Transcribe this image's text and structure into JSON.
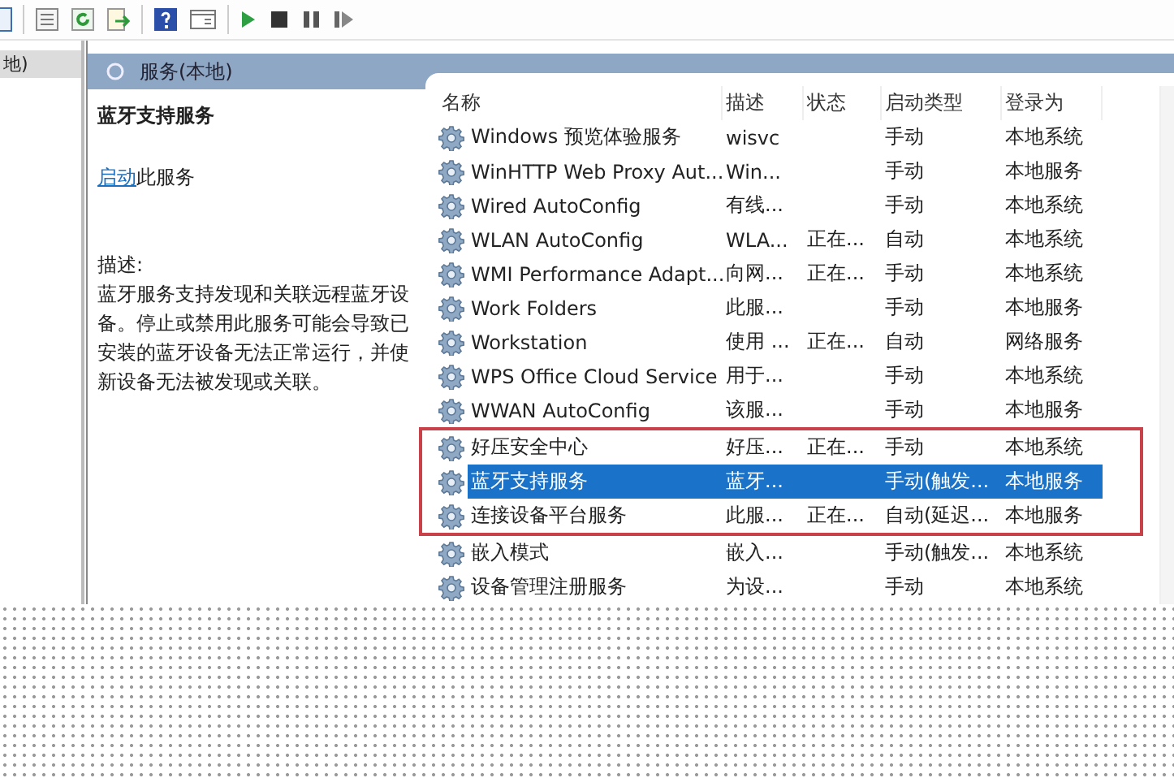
{
  "tree": {
    "items": [
      {
        "label": "地)",
        "selected": true
      }
    ]
  },
  "header": {
    "title": "服务(本地)"
  },
  "detail": {
    "title": "蓝牙支持服务",
    "action_link": "启动",
    "action_text": "此服务",
    "description_label": "描述:",
    "description": "蓝牙服务支持发现和关联远程蓝牙设备。停止或禁用此服务可能会导致已安装的蓝牙设备无法正常运行，并使新设备无法被发现或关联。"
  },
  "table": {
    "columns": [
      "名称",
      "描述",
      "状态",
      "启动类型",
      "登录为"
    ],
    "rows": [
      {
        "name": "Windows 预览体验服务",
        "description": "wisvc",
        "status": "",
        "startup": "手动",
        "logon": "本地系统",
        "selected": false,
        "marked": false
      },
      {
        "name": "WinHTTP Web Proxy Aut...",
        "description": "Win...",
        "status": "",
        "startup": "手动",
        "logon": "本地服务",
        "selected": false,
        "marked": false
      },
      {
        "name": "Wired AutoConfig",
        "description": "有线...",
        "status": "",
        "startup": "手动",
        "logon": "本地系统",
        "selected": false,
        "marked": false
      },
      {
        "name": "WLAN AutoConfig",
        "description": "WLA...",
        "status": "正在...",
        "startup": "自动",
        "logon": "本地系统",
        "selected": false,
        "marked": false
      },
      {
        "name": "WMI Performance Adapt...",
        "description": "向网...",
        "status": "正在...",
        "startup": "手动",
        "logon": "本地系统",
        "selected": false,
        "marked": false
      },
      {
        "name": "Work Folders",
        "description": "此服...",
        "status": "",
        "startup": "手动",
        "logon": "本地服务",
        "selected": false,
        "marked": false
      },
      {
        "name": "Workstation",
        "description": "使用 ...",
        "status": "正在...",
        "startup": "自动",
        "logon": "网络服务",
        "selected": false,
        "marked": false
      },
      {
        "name": "WPS Office Cloud Service",
        "description": "用于...",
        "status": "",
        "startup": "手动",
        "logon": "本地系统",
        "selected": false,
        "marked": false
      },
      {
        "name": "WWAN AutoConfig",
        "description": "该服...",
        "status": "",
        "startup": "手动",
        "logon": "本地服务",
        "selected": false,
        "marked": false
      },
      {
        "name": "好压安全中心",
        "description": "好压...",
        "status": "正在...",
        "startup": "手动",
        "logon": "本地系统",
        "selected": false,
        "marked": true
      },
      {
        "name": "蓝牙支持服务",
        "description": "蓝牙...",
        "status": "",
        "startup": "手动(触发...",
        "logon": "本地服务",
        "selected": true,
        "marked": true
      },
      {
        "name": "连接设备平台服务",
        "description": "此服...",
        "status": "正在...",
        "startup": "自动(延迟...",
        "logon": "本地服务",
        "selected": false,
        "marked": true
      },
      {
        "name": "嵌入模式",
        "description": "嵌入...",
        "status": "",
        "startup": "手动(触发...",
        "logon": "本地系统",
        "selected": false,
        "marked": false
      },
      {
        "name": "设备管理注册服务",
        "description": "为设...",
        "status": "",
        "startup": "手动",
        "logon": "本地系统",
        "selected": false,
        "marked": false
      }
    ]
  }
}
